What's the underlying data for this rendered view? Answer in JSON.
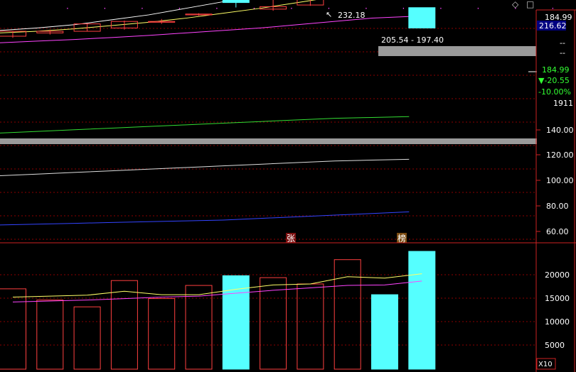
{
  "colors": {
    "background": "#000000",
    "up": "#ff4040",
    "down": "#55ffff",
    "grid": "#8b0000",
    "axis_text": "#ffffff",
    "ma5": "#ffffff",
    "ma10": "#ffff66",
    "ma20": "#ff44ff",
    "ma60": "#33dd33",
    "ma120": "#dddddd",
    "ma250": "#3344ff",
    "price_tag_bg": "#000080"
  },
  "header_markers": [
    "·",
    "·",
    "·",
    "·",
    "·",
    "·",
    "·",
    "·",
    "·",
    "·",
    "·",
    "·",
    "·",
    "·",
    "·"
  ],
  "corner_icons": {
    "diamond": "◇",
    "box": "□"
  },
  "price_panel": {
    "y_ticks": [
      "140.00",
      "120.00",
      "100.00",
      "80.00",
      "60.00"
    ],
    "right_labels": {
      "top_price": "184.99",
      "current_tag": "216.62",
      "dash1": "--",
      "dash2": "--",
      "last": "184.99",
      "change": "▼-20.55",
      "change_pct": "-10.00%",
      "count": "1911"
    },
    "high_annotation": "232.18",
    "high_arrow": "↖",
    "range_annotation": "205.54 - 197.40",
    "markers": [
      "张",
      "榜"
    ]
  },
  "volume_panel": {
    "y_ticks": [
      "20000",
      "15000",
      "10000",
      "5000"
    ],
    "unit": "X10"
  },
  "chart_data": {
    "type": "candlestick",
    "price_axis": {
      "range": [
        55,
        196
      ]
    },
    "candles": [
      {
        "o": 180.0,
        "c": 183.0,
        "h": 183.0,
        "l": 179.0
      },
      {
        "o": 182.0,
        "c": 183.0,
        "h": 184.0,
        "l": 181.0
      },
      {
        "o": 183.0,
        "c": 187.5,
        "h": 187.5,
        "l": 183.0
      },
      {
        "o": 185.0,
        "c": 189.0,
        "h": 189.5,
        "l": 184.0
      },
      {
        "o": 188.5,
        "c": 189.0,
        "h": 190.5,
        "l": 187.5
      },
      {
        "o": 193.0,
        "c": 193.5,
        "h": 194.0,
        "l": 192.5
      },
      {
        "o": 203.0,
        "c": 200.5,
        "h": 204.5,
        "l": 197.5
      },
      {
        "o": 196.5,
        "c": 198.0,
        "h": 204.0,
        "l": 195.5
      },
      {
        "o": 199.0,
        "c": 208.0,
        "h": 209.0,
        "l": 198.5
      },
      {
        "o": 216.0,
        "c": 220.0,
        "h": 232.18,
        "l": 214.0
      },
      {
        "o": 216.62,
        "c": 205.54,
        "h": 220.0,
        "l": 205.54
      },
      {
        "o": 197.4,
        "c": 184.99,
        "h": 197.4,
        "l": 184.99
      }
    ],
    "moving_averages": {
      "ma5": [
        183.5,
        185.0,
        187.0,
        190.0,
        193.0,
        197.0,
        201.0,
        205.0,
        209.0,
        213.5,
        215.5,
        214.0
      ],
      "ma10": [
        182.0,
        183.0,
        184.5,
        186.5,
        188.5,
        191.0,
        194.0,
        197.0,
        200.5,
        204.0,
        207.0,
        208.5
      ],
      "ma20": [
        176.0,
        177.0,
        178.0,
        179.2,
        180.5,
        182.0,
        183.5,
        185.0,
        187.0,
        189.0,
        191.0,
        192.0
      ],
      "ma60": [
        121.0,
        122.0,
        123.0,
        124.0,
        125.0,
        126.0,
        127.0,
        128.0,
        129.0,
        130.0,
        130.5,
        131.0
      ],
      "ma120": [
        95.0,
        96.0,
        97.0,
        98.0,
        99.0,
        100.0,
        101.0,
        102.0,
        103.0,
        104.0,
        104.5,
        105.0
      ],
      "ma250": [
        65.0,
        65.5,
        66.0,
        66.5,
        67.0,
        67.5,
        68.0,
        69.0,
        70.0,
        71.0,
        72.0,
        73.0
      ]
    },
    "volume": {
      "range": [
        0,
        24500
      ],
      "bars": [
        16500,
        14200,
        12800,
        18200,
        14500,
        17200,
        19200,
        18800,
        17500,
        22500,
        15300,
        24200
      ],
      "ma5": [
        14800,
        15000,
        15200,
        16000,
        15300,
        15300,
        16400,
        17300,
        17500,
        19000,
        18700,
        19600
      ],
      "ma10": [
        13800,
        14000,
        14200,
        14500,
        14800,
        15000,
        15600,
        16200,
        16700,
        17200,
        17300,
        18100
      ]
    }
  }
}
